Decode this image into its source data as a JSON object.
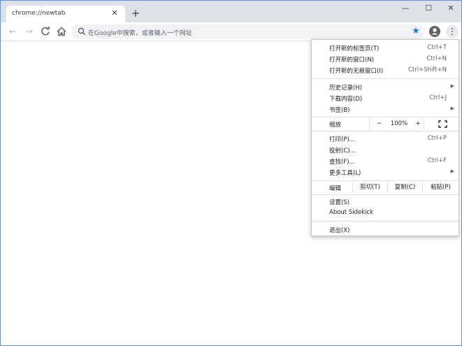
{
  "tab": {
    "title": "chrome://newtab",
    "close": "✕"
  },
  "new_tab": "+",
  "window_controls": {
    "minimize": "—",
    "maximize": "☐",
    "close": "✕"
  },
  "toolbar": {
    "back": "←",
    "forward": "→",
    "reload": "C",
    "omnibox_placeholder": "在Google中搜索，或者输入一个网址",
    "star": "★"
  },
  "menu": {
    "group1": [
      {
        "label": "打开新的标签页(T)",
        "shortcut": "Ctrl+T"
      },
      {
        "label": "打开新的窗口(N)",
        "shortcut": "Ctrl+N"
      },
      {
        "label": "打开新的无痕窗口(I)",
        "shortcut": "Ctrl+Shift+N"
      }
    ],
    "group2": [
      {
        "label": "历史记录(H)",
        "arrow": "▶"
      },
      {
        "label": "下载内容(D)",
        "shortcut": "Ctrl+J"
      },
      {
        "label": "书签(B)",
        "arrow": "▶"
      }
    ],
    "zoom": {
      "label": "缩放",
      "minus": "−",
      "value": "100%",
      "plus": "+"
    },
    "group3": [
      {
        "label": "打印(P)...",
        "shortcut": "Ctrl+P"
      },
      {
        "label": "投射(C)..."
      },
      {
        "label": "查找(F)...",
        "shortcut": "Ctrl+F"
      },
      {
        "label": "更多工具(L)",
        "arrow": "▶"
      }
    ],
    "edit": {
      "label": "编辑",
      "cut": "剪切(T)",
      "copy": "复制(C)",
      "paste": "粘贴(P)"
    },
    "group4": [
      {
        "label": "设置(S)"
      },
      {
        "label": "About Sidekick"
      }
    ],
    "exit": {
      "label": "退出(X)"
    }
  },
  "colors": {
    "titlebar": "#dee1e6",
    "accent": "#1a73e8"
  }
}
